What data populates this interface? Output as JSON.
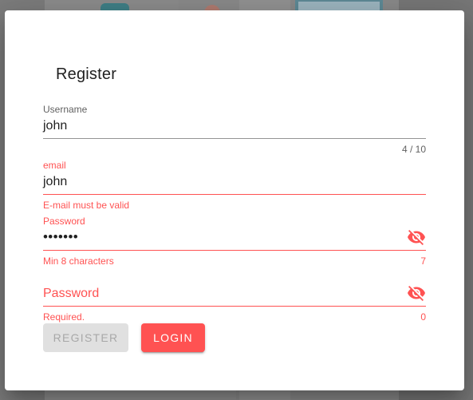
{
  "dialog": {
    "title": "Register"
  },
  "fields": {
    "username": {
      "label": "Username",
      "value": "john",
      "counter": "4 / 10"
    },
    "email": {
      "label": "email",
      "value": "john",
      "error": "E-mail must be valid"
    },
    "password": {
      "label": "Password",
      "value": "•••••••",
      "hint": "Min 8 characters",
      "counter": "7",
      "toggle_icon": "eye-off-icon"
    },
    "password_confirm": {
      "placeholder": "Password",
      "error": "Required.",
      "counter": "0",
      "toggle_icon": "eye-off-icon"
    }
  },
  "buttons": {
    "register": "REGISTER",
    "login": "LOGIN"
  },
  "colors": {
    "error": "#ff5252",
    "text": "#212121",
    "label": "#616161",
    "disabled_bg": "#e0e0e0",
    "disabled_text": "#a8a8a8"
  }
}
